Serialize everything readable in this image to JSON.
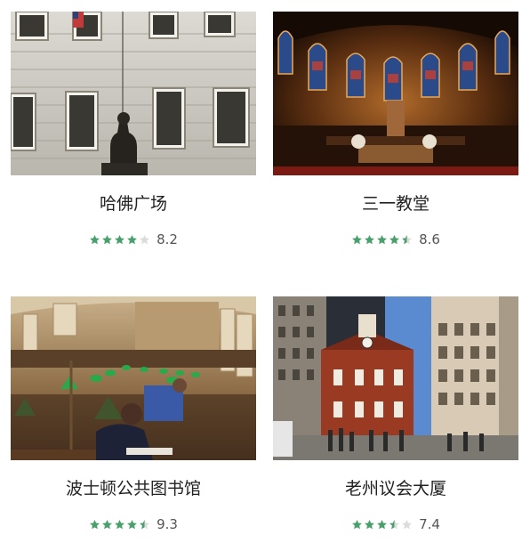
{
  "colors": {
    "star_on": "#4aa06c",
    "star_off": "#dcdcdc",
    "title": "#222222",
    "score": "#555555"
  },
  "cards": [
    {
      "title": "哈佛广场",
      "score": "8.2",
      "rating": 4,
      "photo": "statue-in-front-of-stone-building"
    },
    {
      "title": "三一教堂",
      "score": "8.6",
      "rating": 4.5,
      "photo": "church-interior-stained-glass"
    },
    {
      "title": "波士顿公共图书馆",
      "score": "9.3",
      "rating": 4.5,
      "photo": "library-reading-room-green-lamps"
    },
    {
      "title": "老州议会大厦",
      "score": "7.4",
      "rating": 3.5,
      "photo": "old-state-house-brick-building"
    }
  ]
}
